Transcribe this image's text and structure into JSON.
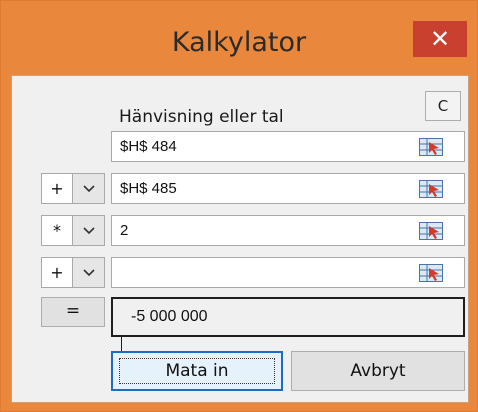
{
  "window": {
    "title": "Kalkylator",
    "close_glyph": "✕"
  },
  "header": {
    "ref_label": "Hänvisning eller tal",
    "clear_label": "C"
  },
  "rows": [
    {
      "operator": "",
      "value": "$H$ 484"
    },
    {
      "operator": "+",
      "value": "$H$ 485"
    },
    {
      "operator": "*",
      "value": "2"
    },
    {
      "operator": "+",
      "value": ""
    }
  ],
  "result": {
    "equals_label": "=",
    "value": "-5 000 000"
  },
  "buttons": {
    "ok_label": "Mata in",
    "cancel_label": "Avbryt"
  },
  "icons": {
    "ref_picker": "range-picker-icon",
    "dropdown": "chevron-down-icon"
  },
  "colors": {
    "titlebar": "#e9873c",
    "close": "#c9402f",
    "focus_border": "#1c6bc4"
  }
}
